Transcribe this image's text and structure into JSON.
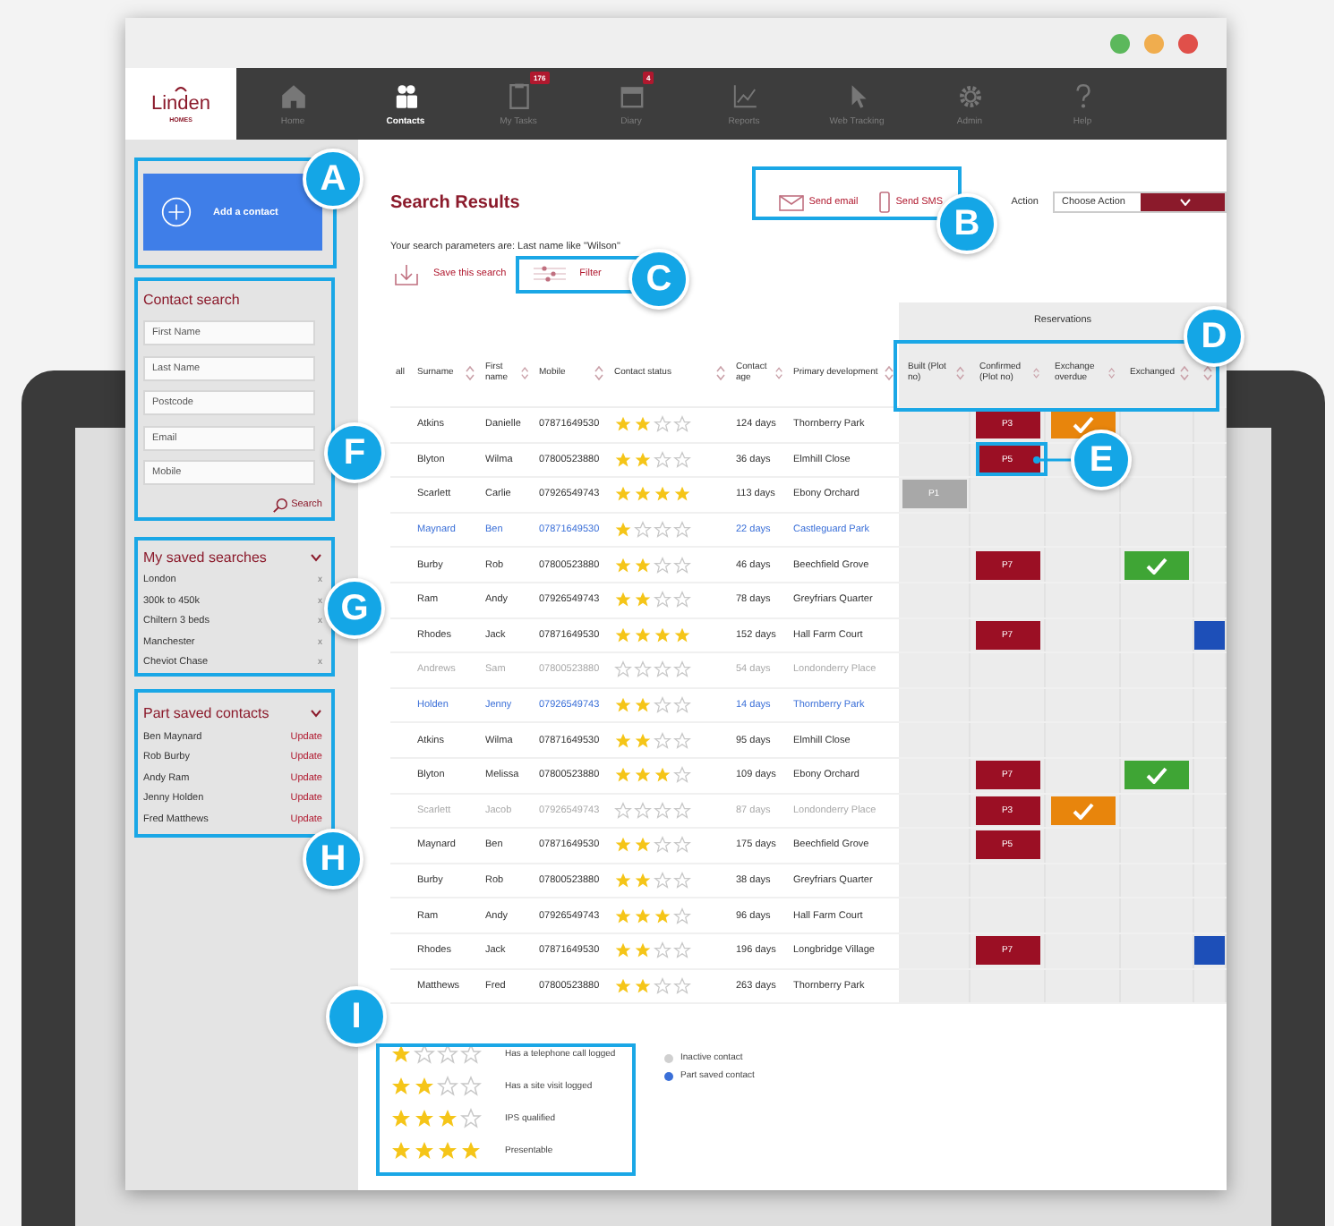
{
  "nav": {
    "logo": "Linden",
    "logo_sub": "HOMES",
    "items": [
      {
        "label": "Home",
        "selected": false
      },
      {
        "label": "Contacts",
        "selected": true
      },
      {
        "label": "My Tasks",
        "selected": false,
        "badge": "176"
      },
      {
        "label": "Diary",
        "selected": false,
        "badge": "4"
      },
      {
        "label": "Reports",
        "selected": false
      },
      {
        "label": "Web Tracking",
        "selected": false
      },
      {
        "label": "Admin",
        "selected": false
      },
      {
        "label": "Help",
        "selected": false
      }
    ]
  },
  "sidebar": {
    "add_contact": "Add a contact",
    "contact_search": {
      "title": "Contact search",
      "fields": [
        {
          "placeholder": "First Name"
        },
        {
          "placeholder": "Last Name"
        },
        {
          "placeholder": "Postcode"
        },
        {
          "placeholder": "Email"
        },
        {
          "placeholder": "Mobile"
        }
      ],
      "search_button": "Search"
    },
    "saved_searches": {
      "title": "My saved searches",
      "items": [
        {
          "label": "London",
          "remove": "x"
        },
        {
          "label": "300k to 450k",
          "remove": "x"
        },
        {
          "label": "Chiltern 3 beds",
          "remove": "x"
        },
        {
          "label": "Manchester",
          "remove": "x"
        },
        {
          "label": "Cheviot Chase",
          "remove": "x"
        }
      ]
    },
    "part_saved_contacts": {
      "title": "Part saved contacts",
      "items": [
        {
          "name": "Ben Maynard",
          "action": "Update"
        },
        {
          "name": "Rob Burby",
          "action": "Update"
        },
        {
          "name": "Andy Ram",
          "action": "Update"
        },
        {
          "name": "Jenny Holden",
          "action": "Update"
        },
        {
          "name": "Fred Matthews",
          "action": "Update"
        }
      ]
    }
  },
  "main": {
    "title": "Search Results",
    "send_email": "Send email",
    "send_sms": "Send SMS",
    "action_label": "Action",
    "action_value": "Choose Action",
    "search_parameters": "Your search parameters are: Last name like \"Wilson\"",
    "save_search": "Save this search",
    "filter": "Filter"
  },
  "table": {
    "group_header": "Reservations",
    "columns": [
      "all",
      "Surname",
      "First name",
      "Mobile",
      "Contact status",
      "Contact age",
      "Primary development"
    ],
    "reservation_columns": [
      "Built (Plot no)",
      "Confirmed (Plot no)",
      "Exchange overdue",
      "Exchanged"
    ],
    "rows": [
      {
        "surname": "Atkins",
        "first_name": "Danielle",
        "mobile": "07871649530",
        "stars": 2,
        "age": "124 days",
        "development": "Thornberry Park",
        "kind": "normal",
        "reservations": [
          {
            "kind": "confirmed",
            "label": "P3"
          },
          {
            "kind": "exchange_overdue"
          }
        ]
      },
      {
        "surname": "Blyton",
        "first_name": "Wilma",
        "mobile": "07800523880",
        "stars": 2,
        "age": "36 days",
        "development": "Elmhill Close",
        "kind": "normal",
        "reservations": [
          {
            "kind": "confirmed",
            "label": "P5"
          }
        ]
      },
      {
        "surname": "Scarlett",
        "first_name": "Carlie",
        "mobile": "07926549743",
        "stars": 4,
        "age": "113 days",
        "development": "Ebony Orchard",
        "kind": "normal",
        "reservations": [
          {
            "kind": "built",
            "label": "P1"
          }
        ]
      },
      {
        "surname": "Maynard",
        "first_name": "Ben",
        "mobile": "07871649530",
        "stars": 1,
        "age": "22 days",
        "development": "Castleguard Park",
        "kind": "part_saved",
        "reservations": []
      },
      {
        "surname": "Burby",
        "first_name": "Rob",
        "mobile": "07800523880",
        "stars": 2,
        "age": "46 days",
        "development": "Beechfield Grove",
        "kind": "normal",
        "reservations": [
          {
            "kind": "confirmed",
            "label": "P7"
          },
          {
            "kind": "exchanged"
          }
        ]
      },
      {
        "surname": "Ram",
        "first_name": "Andy",
        "mobile": "07926549743",
        "stars": 2,
        "age": "78 days",
        "development": "Greyfriars Quarter",
        "kind": "normal",
        "reservations": []
      },
      {
        "surname": "Rhodes",
        "first_name": "Jack",
        "mobile": "07871649530",
        "stars": 4,
        "age": "152 days",
        "development": "Hall Farm Court",
        "kind": "normal",
        "reservations": [
          {
            "kind": "confirmed",
            "label": "P7"
          },
          {
            "kind": "completed"
          }
        ]
      },
      {
        "surname": "Andrews",
        "first_name": "Sam",
        "mobile": "07800523880",
        "stars": 0,
        "age": "54 days",
        "development": "Londonderry Place",
        "kind": "inactive",
        "reservations": []
      },
      {
        "surname": "Holden",
        "first_name": "Jenny",
        "mobile": "07926549743",
        "stars": 2,
        "age": "14 days",
        "development": "Thornberry Park",
        "kind": "part_saved",
        "reservations": []
      },
      {
        "surname": "Atkins",
        "first_name": "Wilma",
        "mobile": "07871649530",
        "stars": 2,
        "age": "95 days",
        "development": "Elmhill Close",
        "kind": "normal",
        "reservations": []
      },
      {
        "surname": "Blyton",
        "first_name": "Melissa",
        "mobile": "07800523880",
        "stars": 3,
        "age": "109 days",
        "development": "Ebony Orchard",
        "kind": "normal",
        "reservations": [
          {
            "kind": "confirmed",
            "label": "P7"
          },
          {
            "kind": "exchanged"
          }
        ]
      },
      {
        "surname": "Scarlett",
        "first_name": "Jacob",
        "mobile": "07926549743",
        "stars": 0,
        "age": "87 days",
        "development": "Londonderry Place",
        "kind": "inactive",
        "reservations": [
          {
            "kind": "confirmed",
            "label": "P3"
          },
          {
            "kind": "exchange_overdue"
          }
        ]
      },
      {
        "surname": "Maynard",
        "first_name": "Ben",
        "mobile": "07871649530",
        "stars": 2,
        "age": "175 days",
        "development": "Beechfield Grove",
        "kind": "normal",
        "reservations": [
          {
            "kind": "confirmed",
            "label": "P5"
          }
        ]
      },
      {
        "surname": "Burby",
        "first_name": "Rob",
        "mobile": "07800523880",
        "stars": 2,
        "age": "38 days",
        "development": "Greyfriars Quarter",
        "kind": "normal",
        "reservations": []
      },
      {
        "surname": "Ram",
        "first_name": "Andy",
        "mobile": "07926549743",
        "stars": 3,
        "age": "96 days",
        "development": "Hall Farm Court",
        "kind": "normal",
        "reservations": []
      },
      {
        "surname": "Rhodes",
        "first_name": "Jack",
        "mobile": "07871649530",
        "stars": 2,
        "age": "196 days",
        "development": "Longbridge Village",
        "kind": "normal",
        "reservations": [
          {
            "kind": "confirmed",
            "label": "P7"
          },
          {
            "kind": "completed"
          }
        ]
      },
      {
        "surname": "Matthews",
        "first_name": "Fred",
        "mobile": "07800523880",
        "stars": 2,
        "age": "263 days",
        "development": "Thornberry Park",
        "kind": "normal",
        "reservations": []
      }
    ]
  },
  "star_legend": [
    {
      "stars": 1,
      "label": "Has a telephone call logged"
    },
    {
      "stars": 2,
      "label": "Has a site visit logged"
    },
    {
      "stars": 3,
      "label": "IPS qualified"
    },
    {
      "stars": 4,
      "label": "Presentable"
    }
  ],
  "contact_legend": [
    {
      "label": "Inactive contact",
      "color": "#d0d0d0"
    },
    {
      "label": "Part saved contact",
      "color": "#3a6fd8"
    }
  ],
  "callouts": [
    {
      "letter": "A"
    },
    {
      "letter": "B"
    },
    {
      "letter": "C"
    },
    {
      "letter": "D"
    },
    {
      "letter": "E"
    },
    {
      "letter": "F"
    },
    {
      "letter": "G"
    },
    {
      "letter": "H"
    },
    {
      "letter": "I"
    }
  ]
}
